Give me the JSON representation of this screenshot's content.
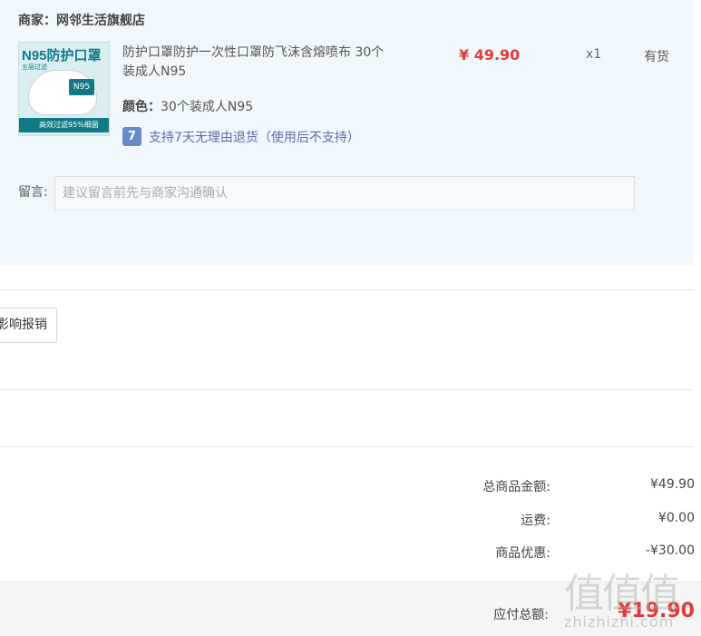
{
  "shop": {
    "merchant_label": "商家：网邻生活旗舰店",
    "product": {
      "thumb_brand": "N95",
      "thumb_title": "防护口罩",
      "thumb_sub": "五层过滤",
      "thumb_banner": "高效过滤95%细菌",
      "title": "防护口罩防护一次性口罩防飞沫含熔喷布 30个装成人N95",
      "price": "¥ 49.90",
      "quantity": "x1",
      "stock": "有货",
      "color_label": "颜色：",
      "color_value": "30个装成人N95",
      "return_icon_text": "7",
      "return_policy": "支持7天无理由退货（使用后不支持）"
    },
    "message_label": "留言:",
    "message_placeholder": "建议留言前先与商家沟通确认"
  },
  "invoice": {
    "report_button": "影响报销"
  },
  "summary": {
    "total_label": "总商品金额:",
    "total_value": "¥49.90",
    "shipping_label": "运费:",
    "shipping_value": "¥0.00",
    "discount_label": "商品优惠:",
    "discount_value": "-¥30.00",
    "payable_label": "应付总额:",
    "payable_value": "¥19.90"
  },
  "watermark": {
    "glyphs": "值值值",
    "text": "zhizhizhi.com"
  },
  "colors": {
    "panel_bg": "#f0f8fd",
    "price_red": "#e4393c",
    "link_blue": "#5a6ea8"
  }
}
